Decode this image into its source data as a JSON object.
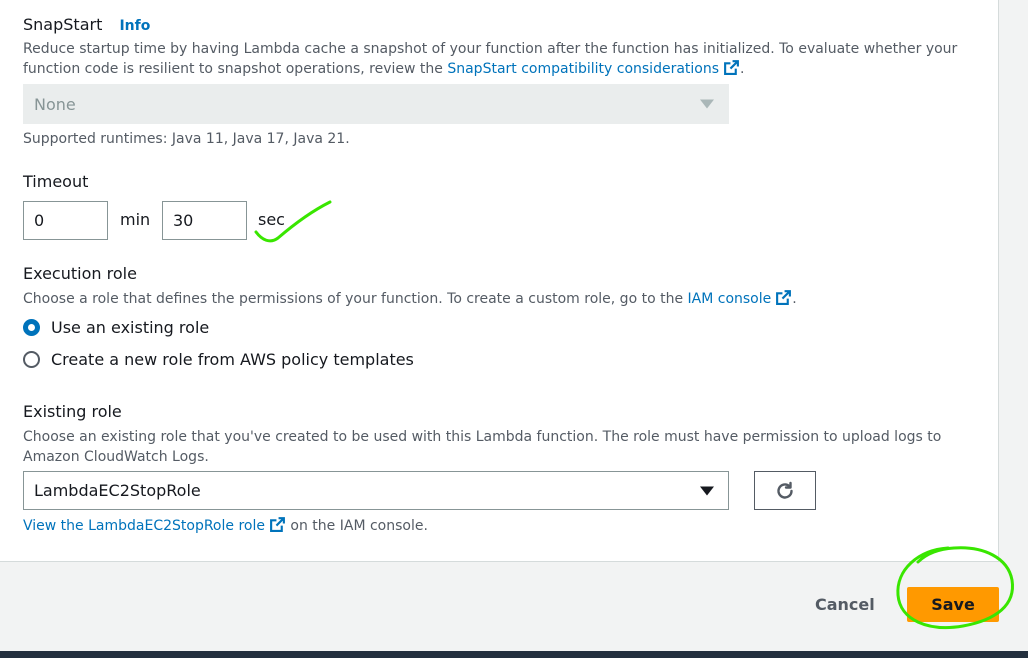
{
  "snapstart": {
    "title": "SnapStart",
    "info": "Info",
    "desc_before": "Reduce startup time by having Lambda cache a snapshot of your function after the function has initialized. To evaluate whether your function code is resilient to snapshot operations, review the ",
    "desc_link": "SnapStart compatibility considerations",
    "desc_after": ".",
    "select_value": "None",
    "supported": "Supported runtimes: Java 11, Java 17, Java 21."
  },
  "timeout": {
    "title": "Timeout",
    "min_value": "0",
    "min_unit": "min",
    "sec_value": "30",
    "sec_unit": "sec"
  },
  "execution_role": {
    "title": "Execution role",
    "desc_before": "Choose a role that defines the permissions of your function. To create a custom role, go to the ",
    "desc_link": "IAM console",
    "desc_after": ".",
    "options": [
      {
        "label": "Use an existing role",
        "checked": true
      },
      {
        "label": "Create a new role from AWS policy templates",
        "checked": false
      }
    ]
  },
  "existing_role": {
    "title": "Existing role",
    "desc": "Choose an existing role that you've created to be used with this Lambda function. The role must have permission to upload logs to Amazon CloudWatch Logs.",
    "select_value": "LambdaEC2StopRole",
    "view_link": "View the LambdaEC2StopRole role",
    "view_after": " on the IAM console."
  },
  "footer": {
    "cancel": "Cancel",
    "save": "Save"
  },
  "colors": {
    "link": "#0073bb",
    "save_bg": "#ff9900",
    "annotation": "#39e600"
  }
}
